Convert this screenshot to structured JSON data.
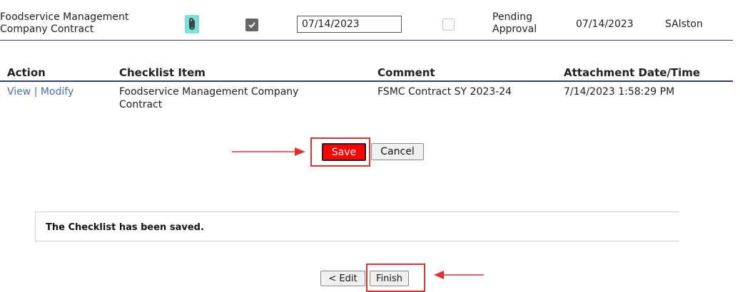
{
  "top_row": {
    "item_name": "Foodservice Management Company Contract",
    "attachment_icon": "paperclip-icon",
    "date_value": "07/14/2023",
    "status": "Pending Approval",
    "status_date": "07/14/2023",
    "user": "SAlston"
  },
  "attachments_table": {
    "headers": [
      "Action",
      "Checklist Item",
      "Comment",
      "Attachment Date/Time"
    ],
    "rows": [
      {
        "view_label": "View",
        "separator": "|",
        "modify_label": "Modify",
        "item": "Foodservice Management Company Contract",
        "comment": "FSMC Contract SY 2023-24",
        "datetime": "7/14/2023 1:58:29 PM"
      }
    ]
  },
  "buttons": {
    "save_label": "Save",
    "cancel_label": "Cancel",
    "edit_label": "< Edit",
    "finish_label": "Finish"
  },
  "message": "The Checklist has been saved.",
  "colors": {
    "header_line": "#2c3a8c",
    "link": "#4a6ea8",
    "save_button": "#ff0000",
    "annotation": "#e03030",
    "attachment_icon_bg": "#7fe0d8"
  }
}
